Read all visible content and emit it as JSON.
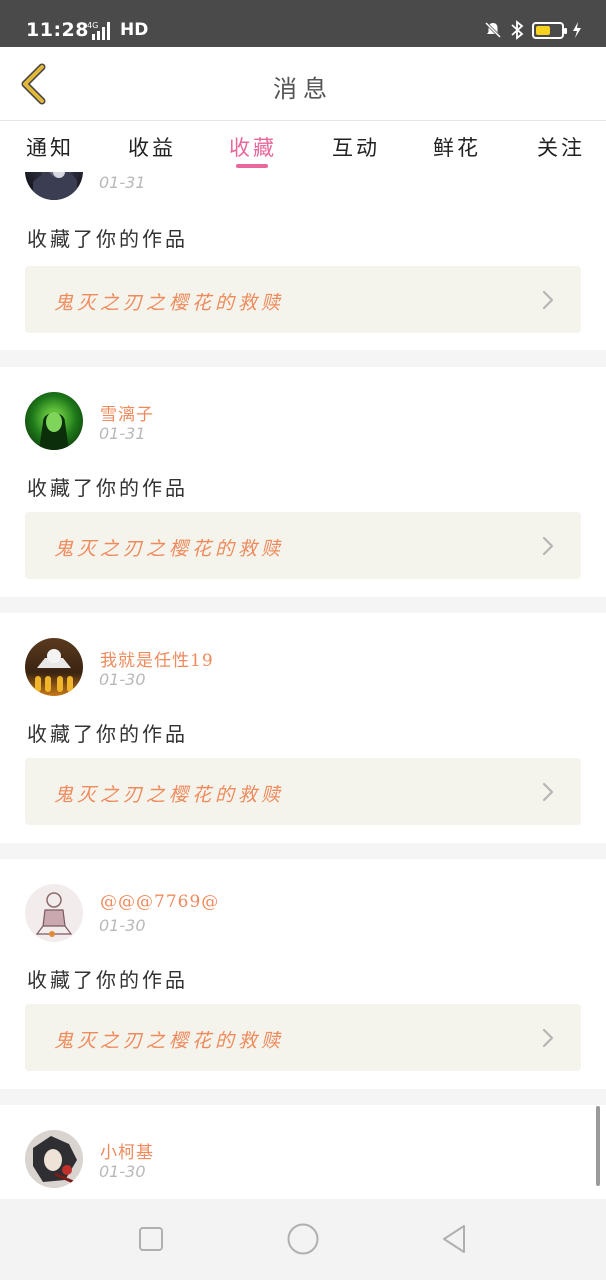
{
  "status_bar": {
    "time": "11:28",
    "network": "4G",
    "hd": "HD",
    "battery_level": 0.6,
    "battery_color": "#f7d21e",
    "icons": [
      "mute-icon",
      "bluetooth-icon",
      "battery-icon",
      "charging-icon"
    ]
  },
  "header": {
    "title": "消息",
    "back_icon": "chevron-left-icon",
    "back_color": "#e2b83a"
  },
  "tabs": [
    {
      "label": "通知",
      "active": false
    },
    {
      "label": "收益",
      "active": false
    },
    {
      "label": "收藏",
      "active": true
    },
    {
      "label": "互动",
      "active": false
    },
    {
      "label": "鲜花",
      "active": false
    },
    {
      "label": "关注",
      "active": false
    }
  ],
  "accent_color": "#e8679c",
  "name_color": "#ef8a5c",
  "items": [
    {
      "username": "",
      "date": "01-31",
      "action": "收藏了你的作品",
      "work_title": "鬼灭之刃之樱花的救赎",
      "avatar": "avatar-dark-anime"
    },
    {
      "username": "雪漓子",
      "date": "01-31",
      "action": "收藏了你的作品",
      "work_title": "鬼灭之刃之樱花的救赎",
      "avatar": "avatar-green-girl"
    },
    {
      "username": "我就是任性19",
      "date": "01-30",
      "action": "收藏了你的作品",
      "work_title": "鬼灭之刃之樱花的救赎",
      "avatar": "avatar-ghost-figure"
    },
    {
      "username": "@@@7769@",
      "date": "01-30",
      "action": "收藏了你的作品",
      "work_title": "鬼灭之刃之樱花的救赎",
      "avatar": "avatar-sketch-girl"
    },
    {
      "username": "小柯基",
      "date": "01-30",
      "action": "",
      "work_title": "",
      "avatar": "avatar-anime-character"
    }
  ],
  "navbar": {
    "icons": [
      "recent-apps-icon",
      "home-icon",
      "back-icon"
    ]
  }
}
